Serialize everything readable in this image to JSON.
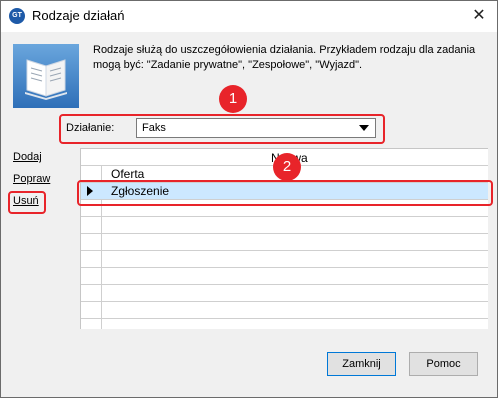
{
  "window": {
    "title": "Rodzaje działań",
    "close_glyph": "✕"
  },
  "app_icon_text": "GT",
  "description": "Rodzaje służą do uszczegółowienia działania. Przykładem rodzaju dla zadania mogą być: \"Zadanie prywatne\", \"Zespołowe\", \"Wyjazd\".",
  "action": {
    "label": "Działanie:",
    "selected": "Faks"
  },
  "sidebar": {
    "links": [
      {
        "label": "Dodaj"
      },
      {
        "label": "Popraw"
      },
      {
        "label": "Usuń"
      }
    ]
  },
  "table": {
    "column_header": "Nazwa",
    "rows": [
      {
        "name": "Oferta",
        "selected": false
      },
      {
        "name": "Zgłoszenie",
        "selected": true
      }
    ]
  },
  "callouts": {
    "first": "1",
    "second": "2"
  },
  "buttons": {
    "close_label": "Zamknij",
    "help_label": "Pomoc"
  },
  "colors": {
    "highlight": "#e8242a",
    "selection": "#cce8ff",
    "focus": "#0078d7"
  }
}
